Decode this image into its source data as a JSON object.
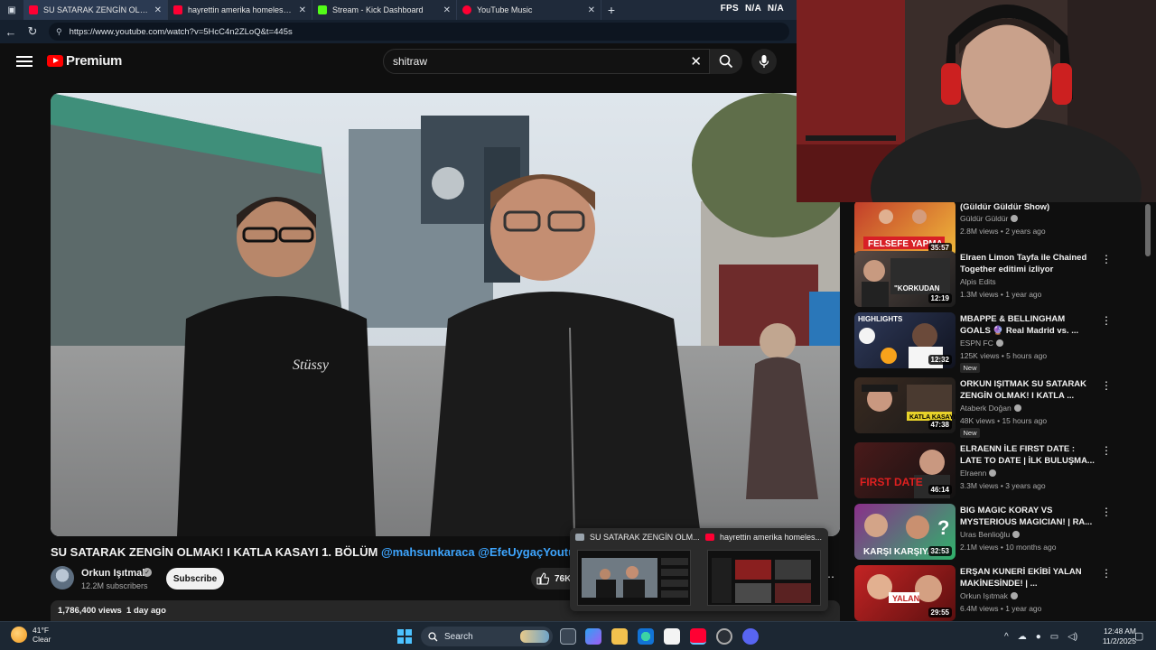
{
  "browser": {
    "tabs": [
      {
        "title": "SU SATARAK ZENGİN OLMAK! I K",
        "active": true,
        "favicon": "youtube-icon"
      },
      {
        "title": "hayrettin amerika homeless - You",
        "active": false,
        "favicon": "youtube-icon"
      },
      {
        "title": "Stream - Kick Dashboard",
        "active": false,
        "favicon": "kick-icon"
      },
      {
        "title": "YouTube Music",
        "active": false,
        "favicon": "youtube-music-icon"
      }
    ],
    "overlay": {
      "fps_label": "FPS",
      "val1": "N/A",
      "val2": "N/A"
    },
    "url": "https://www.youtube.com/watch?v=5HcC4n2ZLoQ&t=445s"
  },
  "youtube": {
    "logo_text": "Premium",
    "search_value": "shitraw",
    "video": {
      "title_main": "SU SATARAK ZENGİN OLMAK! I KATLA KASAYI 1. BÖLÜM ",
      "mention1": "@mahsunkaraca",
      "mention2": " @EfeUygaçYoutube",
      "channel": "Orkun Işıtmak",
      "subscribers": "12.2M subscribers",
      "subscribe_label": "Subscribe",
      "likes": "76K",
      "description_meta": "1,786,400 views  1 day ago"
    },
    "recommendations": [
      {
        "title": "(Güldür Güldür Show)",
        "channel": "Güldür Güldür",
        "verified": true,
        "meta": "2.8M views • 2 years ago",
        "duration": "35:57",
        "badge": ""
      },
      {
        "title": "Elraen Limon Tayfa ile Chained Together editimi izliyor",
        "channel": "Alpis Edits",
        "verified": false,
        "meta": "1.3M views • 1 year ago",
        "duration": "12:19",
        "badge": ""
      },
      {
        "title": "MBAPPE & BELLINGHAM GOALS 🔮 Real Madrid vs. ...",
        "channel": "ESPN FC",
        "verified": true,
        "meta": "125K views • 5 hours ago",
        "duration": "12:32",
        "badge": "New"
      },
      {
        "title": "ORKUN IŞITMAK SU SATARAK ZENGİN OLMAK! I KATLA ...",
        "channel": "Ataberk Doğan",
        "verified": true,
        "meta": "48K views • 15 hours ago",
        "duration": "47:38",
        "badge": "New"
      },
      {
        "title": "ELRAENN İLE FIRST DATE : LATE TO DATE | İLK BULUŞMA...",
        "channel": "Elraenn",
        "verified": true,
        "meta": "3.3M views • 3 years ago",
        "duration": "46:14",
        "badge": ""
      },
      {
        "title": "BIG MAGIC KORAY VS MYSTERIOUS MAGICIAN! | RA...",
        "channel": "Uras Benlioğlu",
        "verified": true,
        "meta": "2.1M views • 10 months ago",
        "duration": "32:53",
        "badge": ""
      },
      {
        "title": "ERŞAN KUNERİ EKİBİ YALAN MAKİNESİNDE! | ...",
        "channel": "Orkun Işıtmak",
        "verified": true,
        "meta": "6.4M views • 1 year ago",
        "duration": "29:55",
        "badge": ""
      }
    ]
  },
  "taskbar_preview": {
    "items": [
      {
        "title": "SU SATARAK ZENGİN OLM..."
      },
      {
        "title": "hayrettin amerika homeles..."
      }
    ]
  },
  "taskbar": {
    "weather_temp": "41°F",
    "weather_cond": "Clear",
    "search_label": "Search",
    "time": "12:48 AM",
    "date": "11/2/2025"
  }
}
